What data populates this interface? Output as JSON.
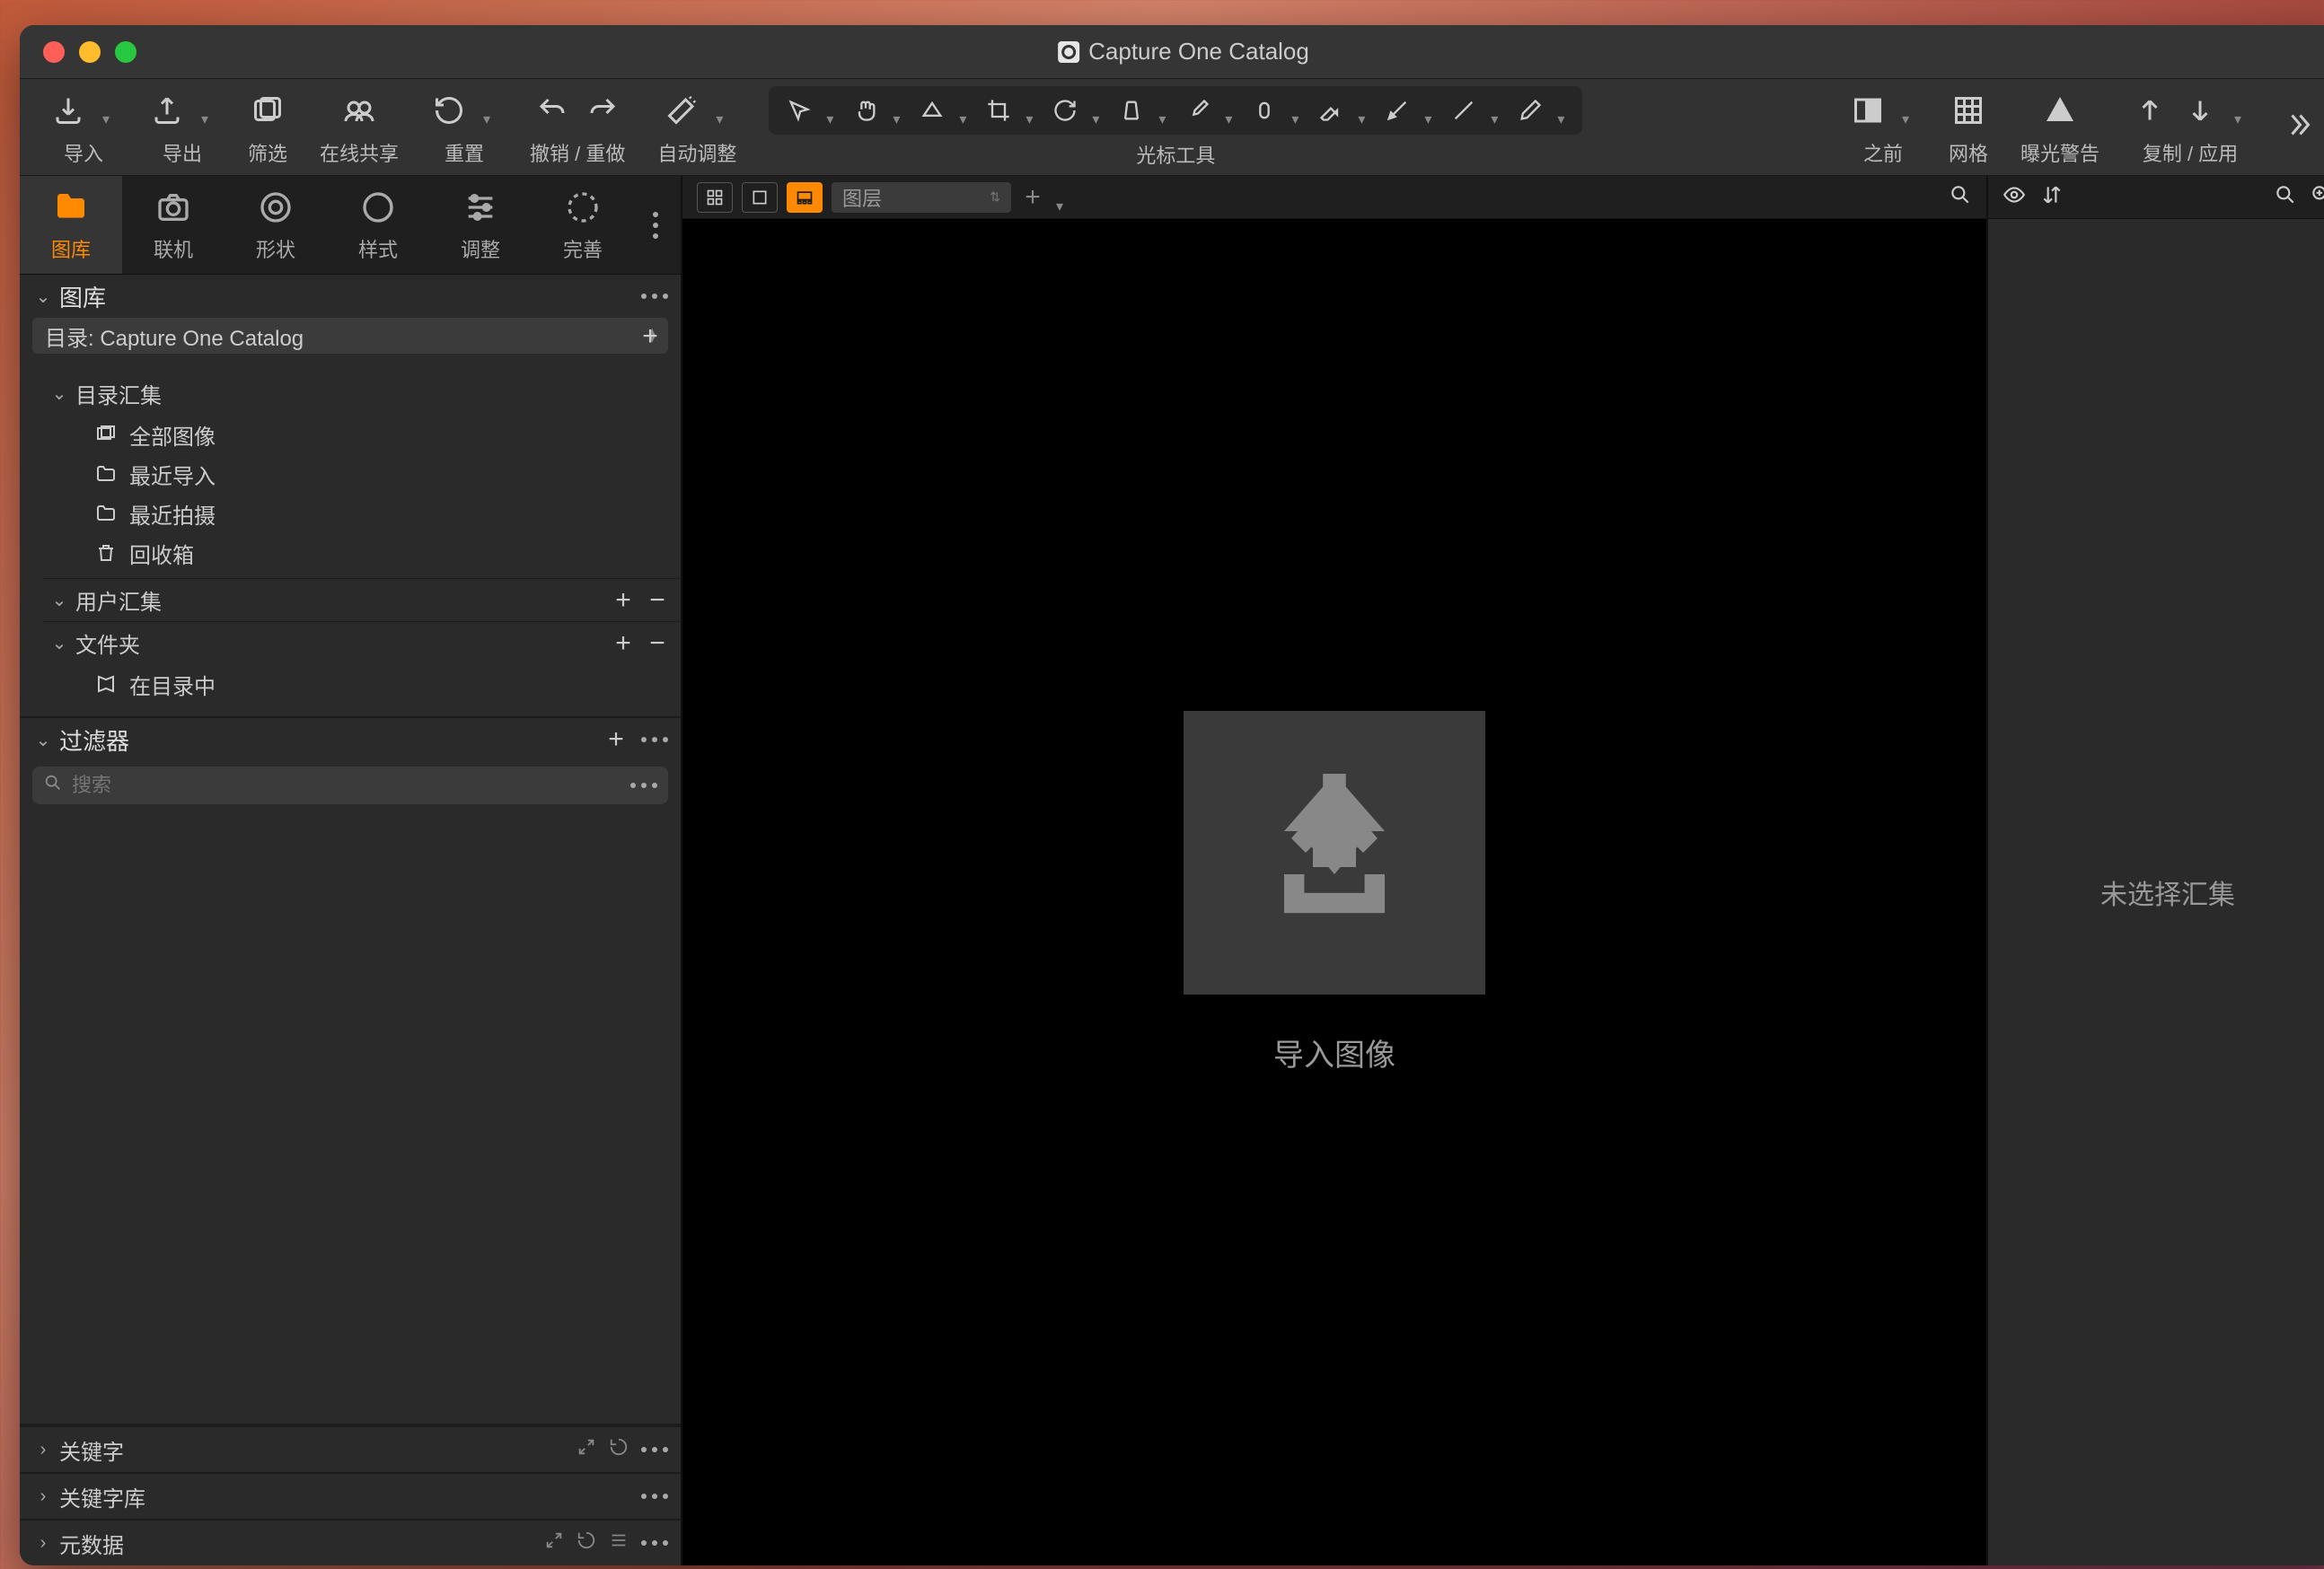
{
  "window_title": "Capture One Catalog",
  "toolbar": {
    "import": "导入",
    "export": "导出",
    "cull": "筛选",
    "share": "在线共享",
    "reset": "重置",
    "undo_redo": "撤销 / 重做",
    "auto_adjust": "自动调整",
    "cursor_tools": "光标工具",
    "before": "之前",
    "grid": "网格",
    "exposure_warning": "曝光警告",
    "copy_apply": "复制 / 应用"
  },
  "tool_tabs": {
    "library": "图库",
    "tether": "联机",
    "shape": "形状",
    "style": "样式",
    "adjust": "调整",
    "refine": "完善"
  },
  "library": {
    "title": "图库",
    "catalog_select": "目录: Capture One Catalog",
    "catalog_collections": "目录汇集",
    "all_images": "全部图像",
    "recent_imports": "最近导入",
    "recent_captures": "最近拍摄",
    "trash": "回收箱",
    "user_collections": "用户汇集",
    "folders": "文件夹",
    "in_catalog": "在目录中"
  },
  "filters": {
    "title": "过滤器",
    "search_placeholder": "搜索"
  },
  "collapsed": {
    "keywords": "关键字",
    "keyword_library": "关键字库",
    "metadata": "元数据"
  },
  "viewer": {
    "layer_label": "图层",
    "import_label": "导入图像"
  },
  "right_panel": {
    "no_collection": "未选择汇集"
  }
}
